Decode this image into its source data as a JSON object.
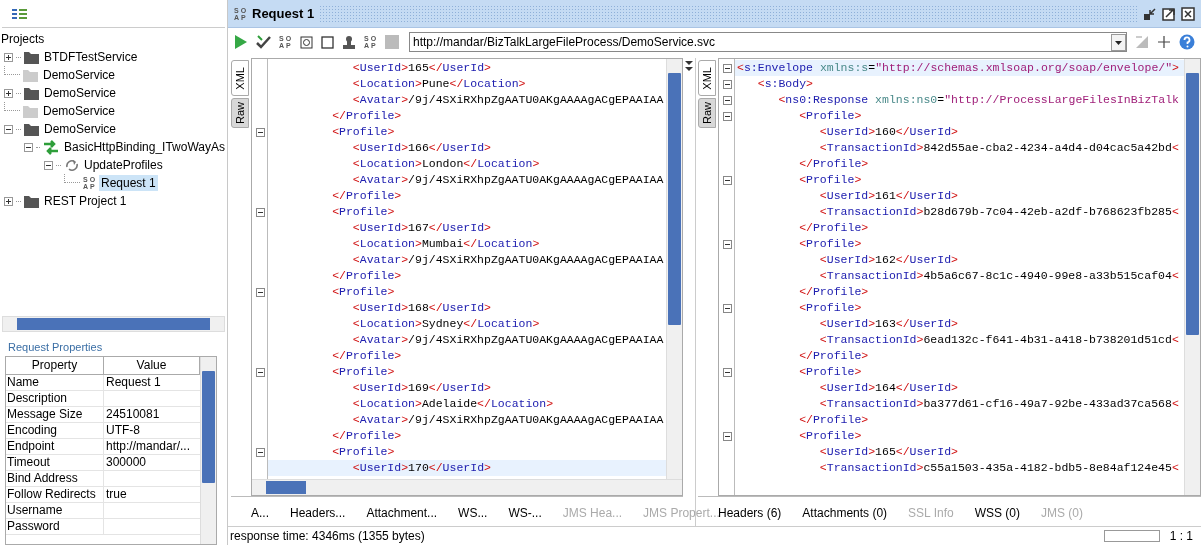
{
  "navigator": {
    "title": "Projects",
    "tree": [
      {
        "label": "BTDFTestService",
        "kind": "project",
        "expanded": false,
        "selected": false
      },
      {
        "label": "DemoService",
        "kind": "unloaded-project",
        "selected": false
      },
      {
        "label": "DemoService",
        "kind": "project",
        "expanded": false,
        "selected": false
      },
      {
        "label": "DemoService",
        "kind": "unloaded-project",
        "selected": false
      },
      {
        "label": "DemoService",
        "kind": "project",
        "expanded": true,
        "selected": false,
        "children": [
          {
            "label": "BasicHttpBinding_ITwoWayAs",
            "kind": "interface",
            "expanded": true,
            "selected": false,
            "children": [
              {
                "label": "UpdateProfiles",
                "kind": "operation",
                "expanded": true,
                "selected": false,
                "children": [
                  {
                    "label": "Request 1",
                    "kind": "request",
                    "icon_text": "SOAP",
                    "selected": true
                  }
                ]
              }
            ]
          }
        ]
      },
      {
        "label": "REST Project 1",
        "kind": "project",
        "expanded": false,
        "selected": false
      }
    ]
  },
  "properties": {
    "title": "Request Properties",
    "columns": [
      "Property",
      "Value"
    ],
    "rows": [
      {
        "property": "Name",
        "value": "Request 1"
      },
      {
        "property": "Description",
        "value": ""
      },
      {
        "property": "Message Size",
        "value": "24510081"
      },
      {
        "property": "Encoding",
        "value": "UTF-8"
      },
      {
        "property": "Endpoint",
        "value": "http://mandar/..."
      },
      {
        "property": "Timeout",
        "value": "300000"
      },
      {
        "property": "Bind Address",
        "value": ""
      },
      {
        "property": "Follow Redirects",
        "value": "true"
      },
      {
        "property": "Username",
        "value": ""
      },
      {
        "property": "Password",
        "value": ""
      }
    ]
  },
  "request_editor": {
    "title": "Request 1",
    "title_icon_text": "SOAP",
    "toolbar": [
      {
        "kind": "run"
      },
      {
        "kind": "validate"
      },
      {
        "kind": "soap",
        "icon_text": "SOAP"
      },
      {
        "kind": "frame"
      },
      {
        "kind": "square"
      },
      {
        "kind": "stamp"
      },
      {
        "kind": "soap",
        "icon_text": "SOAP"
      },
      {
        "kind": "stop"
      }
    ],
    "endpoint": "http://mandar/BizTalkLargeFileProcess/DemoService.svc",
    "request": {
      "side_tabs": [
        {
          "label": "XML",
          "selected": true
        },
        {
          "label": "Raw",
          "selected": false
        }
      ],
      "lines": [
        {
          "text": "            <UserId>165</UserId>",
          "foldable": false,
          "current": false
        },
        {
          "text": "            <Location>Pune</Location>",
          "foldable": false,
          "current": false
        },
        {
          "text": "            <Avatar>/9j/4SXiRXhpZgAATU0AKgAAAAgACgEPAAIAA",
          "foldable": false,
          "current": false
        },
        {
          "text": "         </Profile>",
          "foldable": false,
          "current": false
        },
        {
          "text": "         <Profile>",
          "foldable": true,
          "current": false
        },
        {
          "text": "            <UserId>166</UserId>",
          "foldable": false,
          "current": false
        },
        {
          "text": "            <Location>London</Location>",
          "foldable": false,
          "current": false
        },
        {
          "text": "            <Avatar>/9j/4SXiRXhpZgAATU0AKgAAAAgACgEPAAIAA",
          "foldable": false,
          "current": false
        },
        {
          "text": "         </Profile>",
          "foldable": false,
          "current": false
        },
        {
          "text": "         <Profile>",
          "foldable": true,
          "current": false
        },
        {
          "text": "            <UserId>167</UserId>",
          "foldable": false,
          "current": false
        },
        {
          "text": "            <Location>Mumbai</Location>",
          "foldable": false,
          "current": false
        },
        {
          "text": "            <Avatar>/9j/4SXiRXhpZgAATU0AKgAAAAgACgEPAAIAA",
          "foldable": false,
          "current": false
        },
        {
          "text": "         </Profile>",
          "foldable": false,
          "current": false
        },
        {
          "text": "         <Profile>",
          "foldable": true,
          "current": false
        },
        {
          "text": "            <UserId>168</UserId>",
          "foldable": false,
          "current": false
        },
        {
          "text": "            <Location>Sydney</Location>",
          "foldable": false,
          "current": false
        },
        {
          "text": "            <Avatar>/9j/4SXiRXhpZgAATU0AKgAAAAgACgEPAAIAA",
          "foldable": false,
          "current": false
        },
        {
          "text": "         </Profile>",
          "foldable": false,
          "current": false
        },
        {
          "text": "         <Profile>",
          "foldable": true,
          "current": false
        },
        {
          "text": "            <UserId>169</UserId>",
          "foldable": false,
          "current": false
        },
        {
          "text": "            <Location>Adelaide</Location>",
          "foldable": false,
          "current": false
        },
        {
          "text": "            <Avatar>/9j/4SXiRXhpZgAATU0AKgAAAAgACgEPAAIAA",
          "foldable": false,
          "current": false
        },
        {
          "text": "         </Profile>",
          "foldable": false,
          "current": false
        },
        {
          "text": "         <Profile>",
          "foldable": true,
          "current": false
        },
        {
          "text": "            <UserId>170</UserId>",
          "foldable": false,
          "current": true
        }
      ],
      "bottom_tabs": [
        {
          "label": "A...",
          "disabled": false
        },
        {
          "label": "Headers...",
          "disabled": false
        },
        {
          "label": "Attachment...",
          "disabled": false
        },
        {
          "label": "WS...",
          "disabled": false
        },
        {
          "label": "WS-...",
          "disabled": false
        },
        {
          "label": "JMS Hea...",
          "disabled": true
        },
        {
          "label": "JMS Propert...",
          "disabled": true
        }
      ]
    },
    "response": {
      "side_tabs": [
        {
          "label": "XML",
          "selected": true
        },
        {
          "label": "Raw",
          "selected": false
        }
      ],
      "lines": [
        {
          "text": "<s:Envelope xmlns:s=\"http://schemas.xmlsoap.org/soap/envelope/\">",
          "foldable": true,
          "current": true
        },
        {
          "text": "   <s:Body>",
          "foldable": true,
          "current": false
        },
        {
          "text": "      <ns0:Response xmlns:ns0=\"http://ProcessLargeFilesInBizTalk",
          "foldable": true,
          "current": false
        },
        {
          "text": "         <Profile>",
          "foldable": true,
          "current": false
        },
        {
          "text": "            <UserId>160</UserId>",
          "foldable": false,
          "current": false
        },
        {
          "text": "            <TransactionId>842d55ae-cba2-4234-a4d4-d04cac5a42bd<",
          "foldable": false,
          "current": false
        },
        {
          "text": "         </Profile>",
          "foldable": false,
          "current": false
        },
        {
          "text": "         <Profile>",
          "foldable": true,
          "current": false
        },
        {
          "text": "            <UserId>161</UserId>",
          "foldable": false,
          "current": false
        },
        {
          "text": "            <TransactionId>b28d679b-7c04-42eb-a2df-b768623fb285<",
          "foldable": false,
          "current": false
        },
        {
          "text": "         </Profile>",
          "foldable": false,
          "current": false
        },
        {
          "text": "         <Profile>",
          "foldable": true,
          "current": false
        },
        {
          "text": "            <UserId>162</UserId>",
          "foldable": false,
          "current": false
        },
        {
          "text": "            <TransactionId>4b5a6c67-8c1c-4940-99e8-a33b515caf04<",
          "foldable": false,
          "current": false
        },
        {
          "text": "         </Profile>",
          "foldable": false,
          "current": false
        },
        {
          "text": "         <Profile>",
          "foldable": true,
          "current": false
        },
        {
          "text": "            <UserId>163</UserId>",
          "foldable": false,
          "current": false
        },
        {
          "text": "            <TransactionId>6ead132c-f641-4b31-a418-b738201d51cd<",
          "foldable": false,
          "current": false
        },
        {
          "text": "         </Profile>",
          "foldable": false,
          "current": false
        },
        {
          "text": "         <Profile>",
          "foldable": true,
          "current": false
        },
        {
          "text": "            <UserId>164</UserId>",
          "foldable": false,
          "current": false
        },
        {
          "text": "            <TransactionId>ba377d61-cf16-49a7-92be-433ad37ca568<",
          "foldable": false,
          "current": false
        },
        {
          "text": "         </Profile>",
          "foldable": false,
          "current": false
        },
        {
          "text": "         <Profile>",
          "foldable": true,
          "current": false
        },
        {
          "text": "            <UserId>165</UserId>",
          "foldable": false,
          "current": false
        },
        {
          "text": "            <TransactionId>c55a1503-435a-4182-bdb5-8e84af124e45<",
          "foldable": false,
          "current": false
        }
      ],
      "bottom_tabs": [
        {
          "label": "Headers (6)",
          "disabled": false
        },
        {
          "label": "Attachments (0)",
          "disabled": false
        },
        {
          "label": "SSL Info",
          "disabled": true
        },
        {
          "label": "WSS (0)",
          "disabled": false
        },
        {
          "label": "JMS (0)",
          "disabled": true
        }
      ]
    }
  },
  "status_bar": {
    "text": "response time: 4346ms (1355 bytes)",
    "progress": {
      "level": 0
    },
    "position": "1 : 1"
  }
}
